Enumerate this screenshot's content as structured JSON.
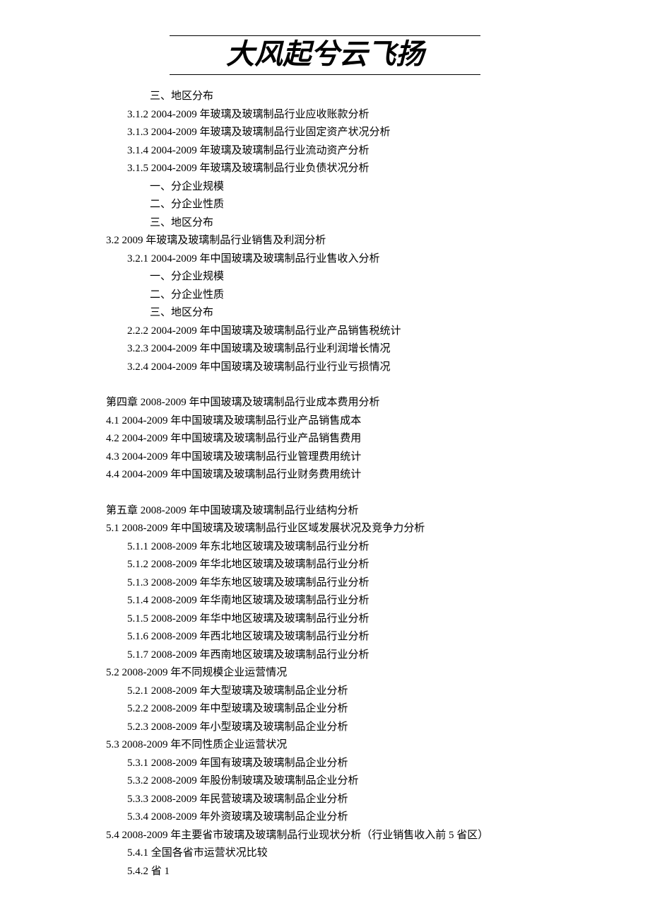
{
  "header_title": "大风起兮云飞扬",
  "lines": [
    {
      "indent": 2,
      "text": "三、地区分布"
    },
    {
      "indent": 1,
      "text": "3.1.2   2004-2009 年玻璃及玻璃制品行业应收账款分析"
    },
    {
      "indent": 1,
      "text": "3.1.3   2004-2009 年玻璃及玻璃制品行业固定资产状况分析"
    },
    {
      "indent": 1,
      "text": "3.1.4   2004-2009 年玻璃及玻璃制品行业流动资产分析"
    },
    {
      "indent": 1,
      "text": "3.1.5   2004-2009 年玻璃及玻璃制品行业负债状况分析"
    },
    {
      "indent": 2,
      "text": "一、分企业规模"
    },
    {
      "indent": 2,
      "text": "二、分企业性质"
    },
    {
      "indent": 2,
      "text": "三、地区分布"
    },
    {
      "indent": 0,
      "text": "  3.2 2009 年玻璃及玻璃制品行业销售及利润分析"
    },
    {
      "indent": 1,
      "text": "3.2.1   2004-2009 年中国玻璃及玻璃制品行业售收入分析"
    },
    {
      "indent": 2,
      "text": "一、分企业规模"
    },
    {
      "indent": 2,
      "text": "二、分企业性质"
    },
    {
      "indent": 2,
      "text": "三、地区分布"
    },
    {
      "indent": 1,
      "text": "2.2.2   2004-2009 年中国玻璃及玻璃制品行业产品销售税统计"
    },
    {
      "indent": 1,
      "text": "3.2.3   2004-2009 年中国玻璃及玻璃制品行业利润增长情况"
    },
    {
      "indent": 1,
      "text": "3.2.4   2004-2009 年中国玻璃及玻璃制品行业行业亏损情况"
    },
    {
      "indent": 0,
      "text": "",
      "spacer": true
    },
    {
      "indent": 0,
      "text": "第四章    2008-2009 年中国玻璃及玻璃制品行业成本费用分析"
    },
    {
      "indent": 0,
      "text": "4.1     2004-2009 年中国玻璃及玻璃制品行业产品销售成本"
    },
    {
      "indent": 0,
      "text": "4.2     2004-2009 年中国玻璃及玻璃制品行业产品销售费用"
    },
    {
      "indent": 0,
      "text": "4.3     2004-2009 年中国玻璃及玻璃制品行业管理费用统计"
    },
    {
      "indent": 0,
      "text": "4.4     2004-2009 年中国玻璃及玻璃制品行业财务费用统计"
    },
    {
      "indent": 0,
      "text": "",
      "spacer": true
    },
    {
      "indent": 0,
      "text": "第五章    2008-2009 年中国玻璃及玻璃制品行业结构分析"
    },
    {
      "indent": 0,
      "text": "5.1 2008-2009 年中国玻璃及玻璃制品行业区域发展状况及竞争力分析"
    },
    {
      "indent": 1,
      "text": "5.1.1   2008-2009 年东北地区玻璃及玻璃制品行业分析"
    },
    {
      "indent": 1,
      "text": "5.1.2   2008-2009 年华北地区玻璃及玻璃制品行业分析"
    },
    {
      "indent": 1,
      "text": "5.1.3   2008-2009 年华东地区玻璃及玻璃制品行业分析"
    },
    {
      "indent": 1,
      "text": "5.1.4   2008-2009 年华南地区玻璃及玻璃制品行业分析"
    },
    {
      "indent": 1,
      "text": "5.1.5   2008-2009 年华中地区玻璃及玻璃制品行业分析"
    },
    {
      "indent": 1,
      "text": "5.1.6   2008-2009 年西北地区玻璃及玻璃制品行业分析"
    },
    {
      "indent": 1,
      "text": "5.1.7   2008-2009 年西南地区玻璃及玻璃制品行业分析"
    },
    {
      "indent": 0,
      "text": "5.2 2008-2009 年不同规模企业运营情况"
    },
    {
      "indent": 1,
      "text": "5.2.1 2008-2009 年大型玻璃及玻璃制品企业分析"
    },
    {
      "indent": 1,
      "text": "5.2.2 2008-2009 年中型玻璃及玻璃制品企业分析"
    },
    {
      "indent": 1,
      "text": "5.2.3 2008-2009 年小型玻璃及玻璃制品企业分析"
    },
    {
      "indent": 0,
      "text": "5.3   2008-2009 年不同性质企业运营状况"
    },
    {
      "indent": 1,
      "text": "5.3.1 2008-2009 年国有玻璃及玻璃制品企业分析"
    },
    {
      "indent": 1,
      "text": "5.3.2 2008-2009 年股份制玻璃及玻璃制品企业分析"
    },
    {
      "indent": 1,
      "text": "5.3.3 2008-2009 年民营玻璃及玻璃制品企业分析"
    },
    {
      "indent": 1,
      "text": "5.3.4 2008-2009 年外资玻璃及玻璃制品企业分析"
    },
    {
      "indent": 0,
      "text": "5.4 2008-2009 年主要省市玻璃及玻璃制品行业现状分析（行业销售收入前 5 省区）"
    },
    {
      "indent": 1,
      "text": "5.4.1  全国各省市运营状况比较"
    },
    {
      "indent": 1,
      "text": "5.4.2  省 1"
    }
  ]
}
